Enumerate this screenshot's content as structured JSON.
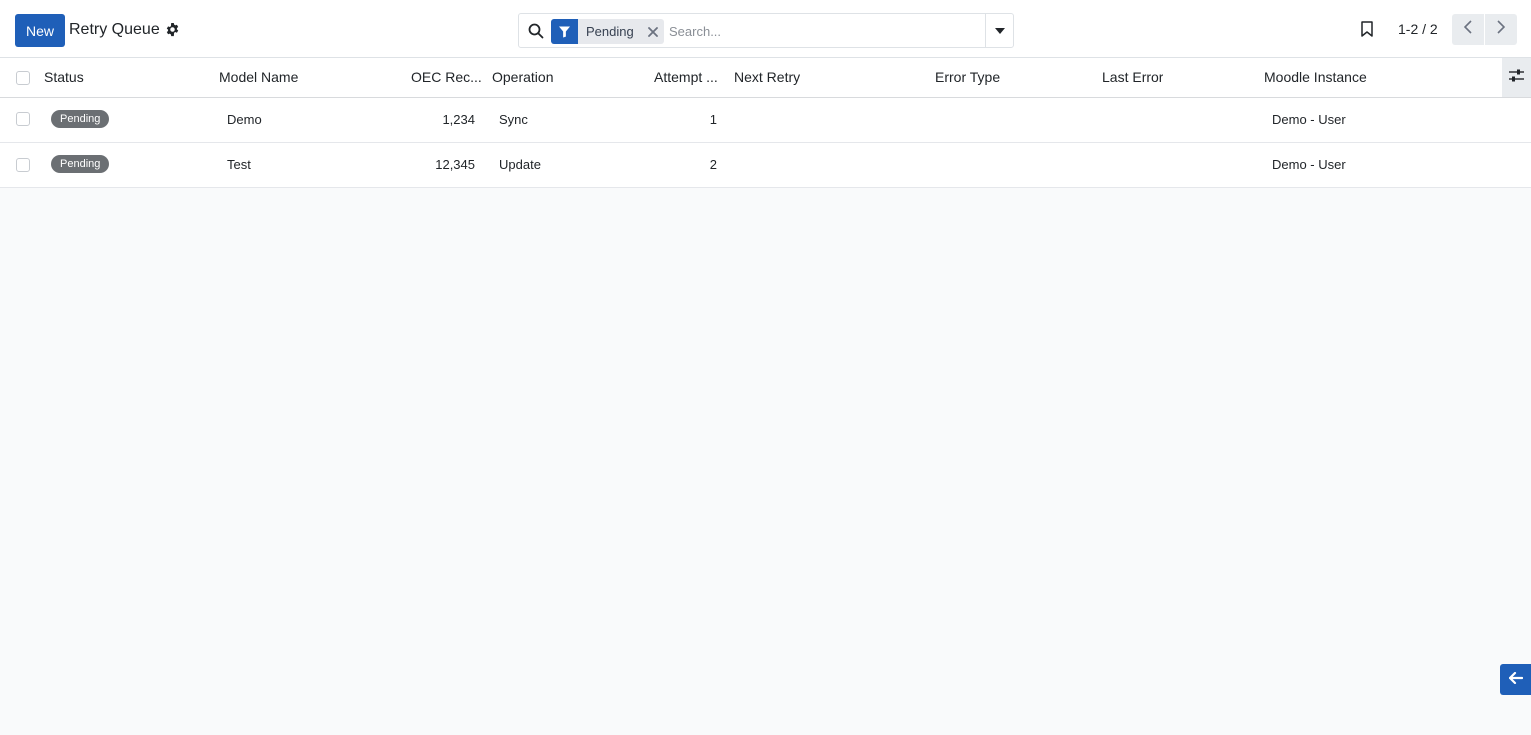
{
  "control_panel": {
    "new_label": "New",
    "title": "Retry Queue",
    "search": {
      "facet_label": "Pending",
      "placeholder": "Search..."
    },
    "pager": {
      "value": "1-2 / 2"
    }
  },
  "table": {
    "columns": {
      "status": "Status",
      "model_name": "Model Name",
      "oec_record": "OEC Rec...",
      "operation": "Operation",
      "attempt": "Attempt ...",
      "next_retry": "Next Retry",
      "error_type": "Error Type",
      "last_error": "Last Error",
      "moodle_instance": "Moodle Instance"
    },
    "rows": [
      {
        "status": "Pending",
        "model_name": "Demo",
        "oec_record": "1,234",
        "operation": "Sync",
        "attempt": "1",
        "next_retry": "",
        "error_type": "",
        "last_error": "",
        "moodle_instance": "Demo - User"
      },
      {
        "status": "Pending",
        "model_name": "Test",
        "oec_record": "12,345",
        "operation": "Update",
        "attempt": "2",
        "next_retry": "",
        "error_type": "",
        "last_error": "",
        "moodle_instance": "Demo - User"
      }
    ]
  },
  "icons": {
    "settings": "gear-icon",
    "search": "search-icon",
    "filter": "filter-icon",
    "remove": "close-icon",
    "dropdown": "caret-down-icon",
    "bookmark": "bookmark-icon",
    "prev": "chevron-left-icon",
    "next": "chevron-right-icon",
    "optional_columns": "sliders-icon",
    "chatter": "arrow-left-icon"
  },
  "colors": {
    "primary": "#1f5fb8",
    "badge": "#6b6f73",
    "background": "#f9fafb"
  }
}
